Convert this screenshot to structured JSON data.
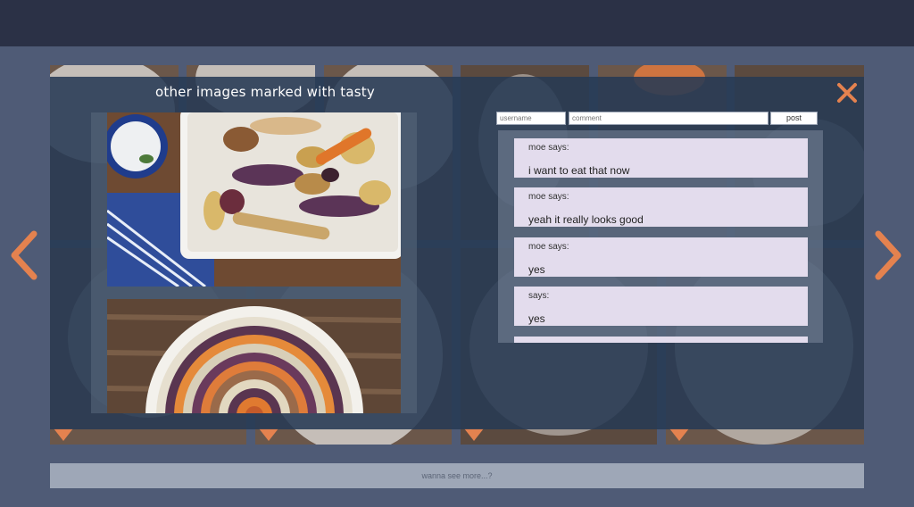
{
  "modal": {
    "title": "other images marked with tasty"
  },
  "comment_form": {
    "username_placeholder": "username",
    "comment_placeholder": "comment",
    "post_label": "post"
  },
  "comments": [
    {
      "author": "moe says:",
      "text": "i want to eat that now"
    },
    {
      "author": "moe says:",
      "text": "yeah it really looks good"
    },
    {
      "author": "moe says:",
      "text": "yes"
    },
    {
      "author": "says:",
      "text": "yes"
    }
  ],
  "tile_pins": [
    "11",
    "2",
    "8",
    "2"
  ],
  "footer": {
    "more_label": "wanna see more...?"
  },
  "colors": {
    "accent": "#e4824f",
    "topbar": "#2b3146",
    "background": "#4f5b76",
    "comment_bg": "#e3dced"
  },
  "icons": {
    "close": "close-icon",
    "prev": "chevron-left-icon",
    "next": "chevron-right-icon"
  }
}
